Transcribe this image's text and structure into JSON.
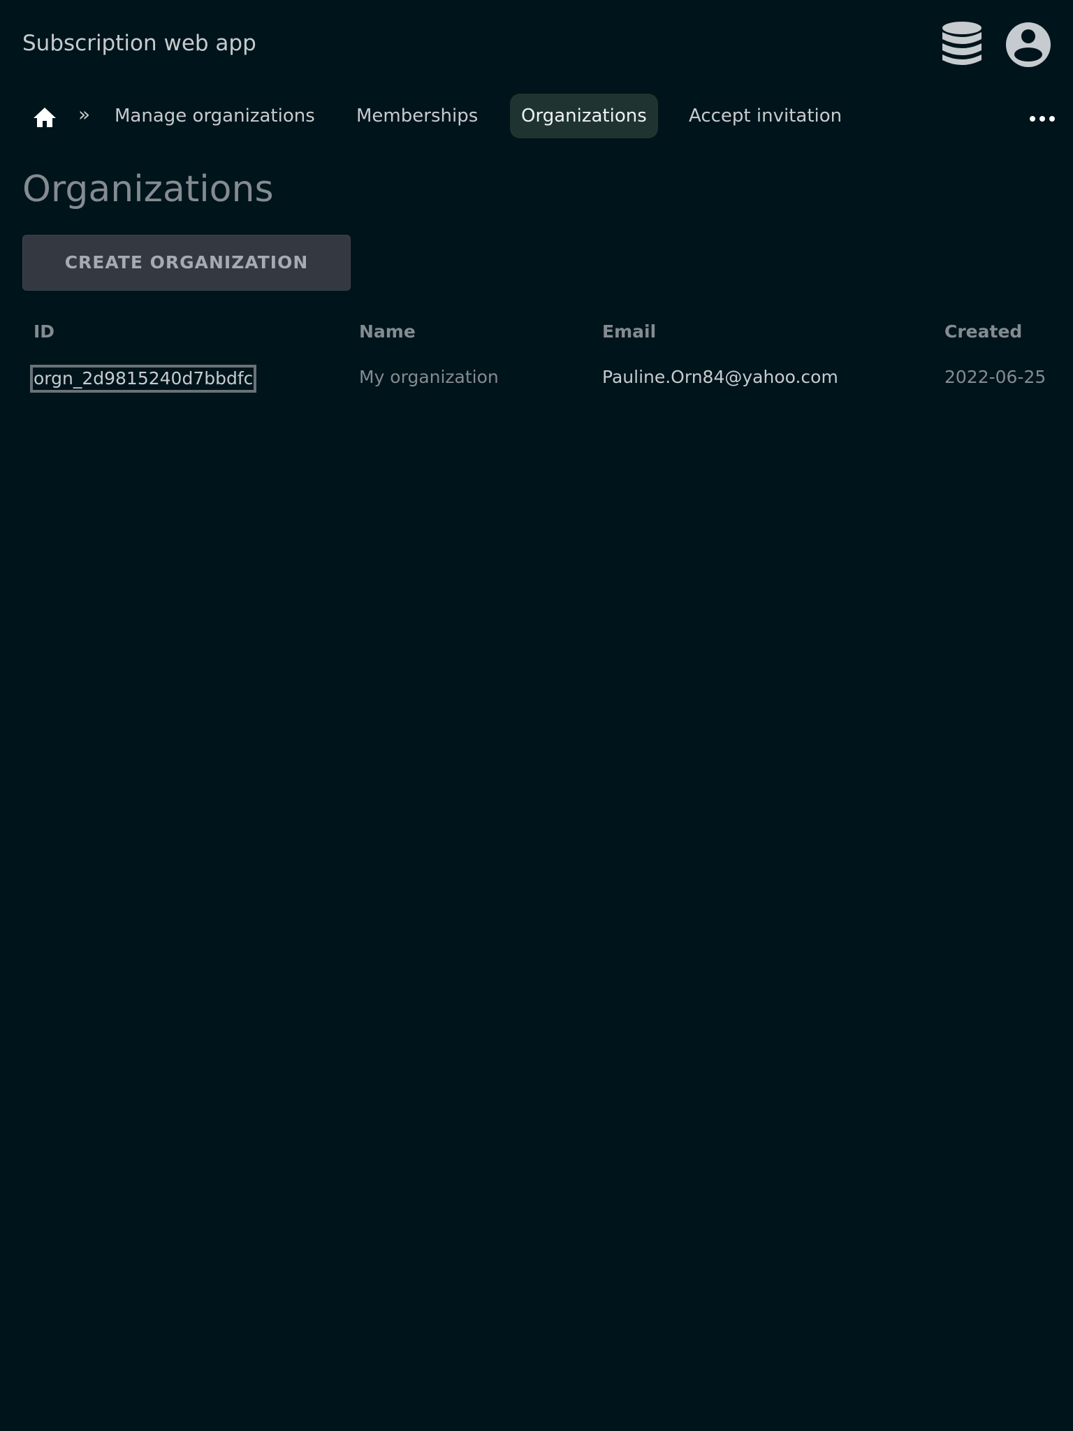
{
  "header": {
    "title": "Subscription web app",
    "icons": [
      "database-icon",
      "account-circle-icon"
    ]
  },
  "navbar": {
    "home_icon": "home-icon",
    "separator": "»",
    "items": [
      {
        "label": "Manage organizations",
        "active": false
      },
      {
        "label": "Memberships",
        "active": false
      },
      {
        "label": "Organizations",
        "active": true
      },
      {
        "label": "Accept invitation",
        "active": false
      }
    ],
    "more_icon": "more-horizontal-icon"
  },
  "page": {
    "heading": "Organizations",
    "create_button_label": "CREATE ORGANIZATION"
  },
  "table": {
    "columns": [
      "ID",
      "Name",
      "Email",
      "Created"
    ],
    "rows": [
      {
        "id": "orgn_2d9815240d7bbdfc",
        "name": "My organization",
        "email": "Pauline.Orn84@yahoo.com",
        "created": "2022-06-25"
      }
    ]
  },
  "colors": {
    "background": "#00141b",
    "active_nav_bg": "#1f3330",
    "button_bg": "#343841",
    "text_light": "#c6cbcf",
    "text_muted": "#848b91"
  }
}
